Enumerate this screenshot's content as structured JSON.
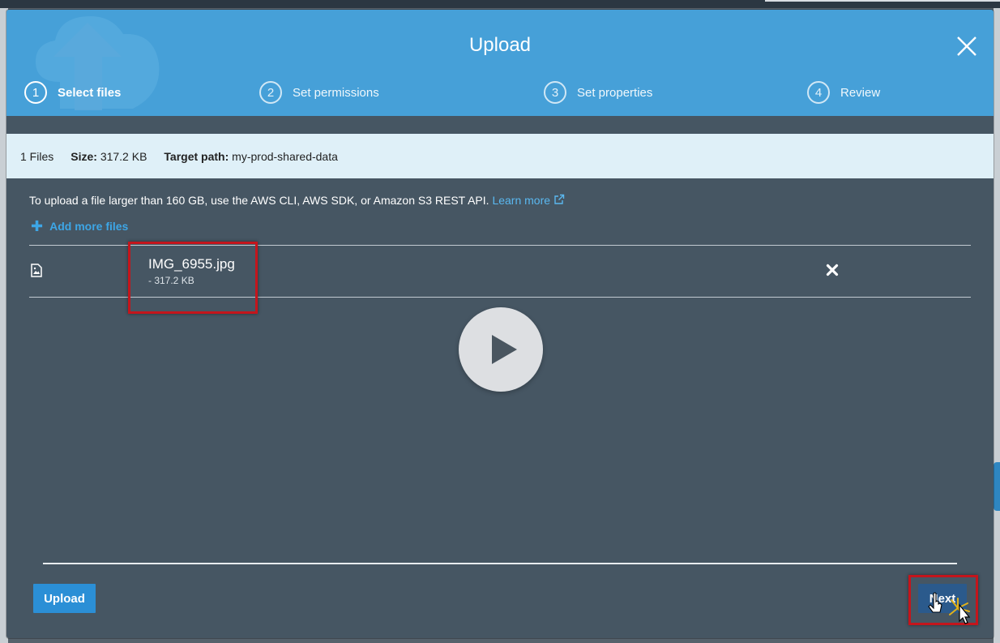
{
  "modal": {
    "title": "Upload",
    "close_icon": "close-icon"
  },
  "steps": [
    {
      "number": "1",
      "label": "Select files",
      "active": true
    },
    {
      "number": "2",
      "label": "Set permissions",
      "active": false
    },
    {
      "number": "3",
      "label": "Set properties",
      "active": false
    },
    {
      "number": "4",
      "label": "Review",
      "active": false
    }
  ],
  "summary": {
    "files": "1 Files",
    "size_label": "Size:",
    "size_value": "317.2 KB",
    "target_label": "Target path:",
    "target_value": "my-prod-shared-data"
  },
  "notice": {
    "text": "To upload a file larger than 160 GB, use the AWS CLI, AWS SDK, or Amazon S3 REST API.",
    "link": "Learn more",
    "link_icon": "external-link-icon"
  },
  "add_more": {
    "icon": "plus-icon",
    "label": "Add more files"
  },
  "files": [
    {
      "name": "IMG_6955.jpg",
      "size": "- 317.2 KB",
      "icon": "image-file-icon",
      "remove_icon": "remove-icon"
    }
  ],
  "video": {
    "icon": "play-icon"
  },
  "footer": {
    "upload_label": "Upload",
    "next_label": "Next"
  },
  "colors": {
    "header": "#46a0d8",
    "body": "#465663",
    "info_bar": "#dff0f8",
    "link": "#5ab8f0",
    "primary_button": "#2b8fd6",
    "next_button": "#2b5a8c",
    "highlight": "#c4151c"
  }
}
